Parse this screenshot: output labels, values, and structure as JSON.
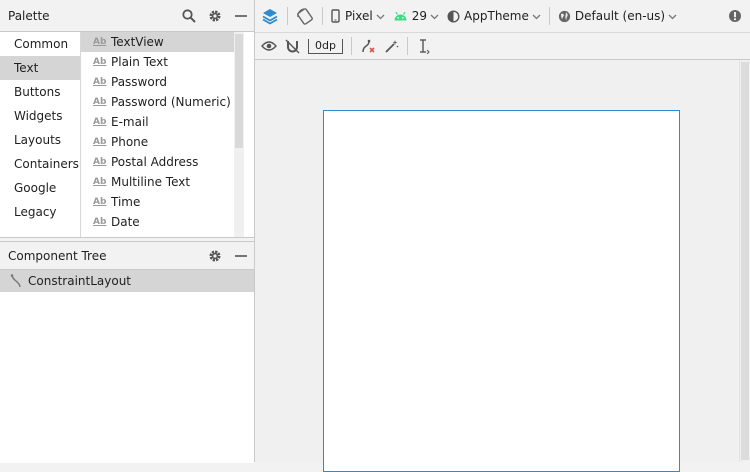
{
  "palette": {
    "title": "Palette",
    "categories": [
      "Common",
      "Text",
      "Buttons",
      "Widgets",
      "Layouts",
      "Containers",
      "Google",
      "Legacy"
    ],
    "selected_category": "Text",
    "widget_badge": "Ab",
    "widgets": [
      "TextView",
      "Plain Text",
      "Password",
      "Password (Numeric)",
      "E-mail",
      "Phone",
      "Postal Address",
      "Multiline Text",
      "Time",
      "Date"
    ],
    "selected_widget": "TextView"
  },
  "component_tree": {
    "title": "Component Tree",
    "items": [
      "ConstraintLayout"
    ]
  },
  "toolbar": {
    "device": "Pixel",
    "api_level": "29",
    "theme": "AppTheme",
    "locale": "Default (en-us)"
  },
  "sub_toolbar": {
    "default_margin": "0dp"
  },
  "colors": {
    "accent_blue": "#2e8bd1",
    "android_green": "#3ddc84",
    "selection": "#d5d5d5",
    "error_red": "#d9534f"
  },
  "icons": [
    "search-icon",
    "gear-icon",
    "minimize-icon",
    "layers-icon",
    "orientation-icon",
    "phone-icon",
    "android-icon",
    "theme-icon",
    "globe-icon",
    "warning-icon",
    "eye-icon",
    "magnet-off-icon",
    "clear-constraints-icon",
    "infer-constraints-icon",
    "guidelines-icon",
    "constraint-icon"
  ]
}
